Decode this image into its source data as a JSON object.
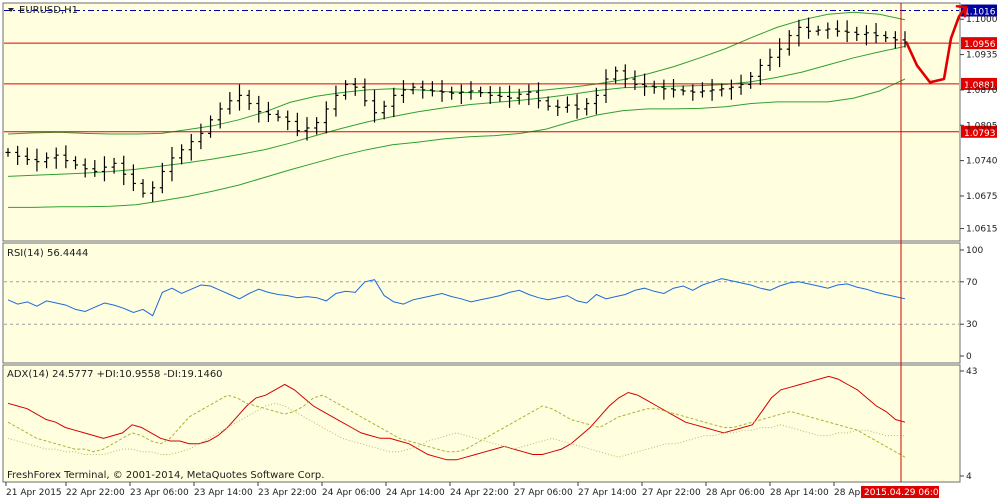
{
  "chart_data": [
    {
      "type": "candlestick",
      "title": "EURUSD,H1",
      "ylim": [
        1.0594,
        1.1028
      ],
      "y_ticks": [
        "1.1000",
        "1.0935",
        "1.0870",
        "1.0805",
        "1.0740",
        "1.0675",
        "1.0615"
      ],
      "x_ticks": [
        "21 Apr 2015",
        "22 Apr 22:00",
        "23 Apr 06:00",
        "23 Apr 14:00",
        "23 Apr 22:00",
        "24 Apr 06:00",
        "24 Apr 14:00",
        "24 Apr 22:00",
        "27 Apr 06:00",
        "27 Apr 14:00",
        "27 Apr 22:00",
        "28 Apr 06:00",
        "28 Apr 14:00",
        "28 Apr",
        "2015.04.29 06:00"
      ],
      "cursor_time": "2015.04.29 06:00",
      "price_levels": [
        {
          "label": "1.1016",
          "value": 1.1016,
          "style": "dash-dot",
          "color": "#0000a0"
        },
        {
          "label": "1.0956",
          "value": 1.0956,
          "style": "solid",
          "color": "#e00000"
        },
        {
          "label": "1.0881",
          "value": 1.0881,
          "style": "solid",
          "color": "#e00000"
        },
        {
          "label": "1.0793",
          "value": 1.0793,
          "style": "solid",
          "color": "#e00000"
        }
      ],
      "bollinger_bands": {
        "upper": [
          1.0789,
          1.0791,
          1.0792,
          1.079,
          1.0789,
          1.0789,
          1.079,
          1.0797,
          1.0804,
          1.0815,
          1.0829,
          1.0847,
          1.0858,
          1.0865,
          1.087,
          1.0872,
          1.087,
          1.0867,
          1.0865,
          1.0865,
          1.0866,
          1.087,
          1.0875,
          1.0881,
          1.0889,
          1.09,
          1.0913,
          1.0929,
          1.0946,
          1.0966,
          1.0985,
          1.0999,
          1.1009,
          1.1013,
          1.1009,
          1.0999
        ],
        "middle": [
          1.0711,
          1.0713,
          1.0715,
          1.0717,
          1.072,
          1.0724,
          1.073,
          1.0736,
          1.0743,
          1.0751,
          1.076,
          1.0772,
          1.0786,
          1.0799,
          1.0811,
          1.0821,
          1.083,
          1.0837,
          1.0843,
          1.0847,
          1.0851,
          1.0856,
          1.0862,
          1.0869,
          1.0874,
          1.0876,
          1.0877,
          1.0878,
          1.088,
          1.0885,
          1.0893,
          1.0903,
          1.0916,
          1.0929,
          1.094,
          1.095
        ],
        "lower": [
          1.0654,
          1.0654,
          1.0655,
          1.0655,
          1.0656,
          1.0659,
          1.0666,
          1.0674,
          1.0684,
          1.0695,
          1.0709,
          1.0723,
          1.0736,
          1.0749,
          1.076,
          1.0769,
          1.0774,
          1.078,
          1.0784,
          1.0786,
          1.079,
          1.0798,
          1.0812,
          1.0824,
          1.0832,
          1.0835,
          1.0835,
          1.0836,
          1.0839,
          1.0845,
          1.0848,
          1.0848,
          1.0848,
          1.0855,
          1.0868,
          1.089
        ]
      },
      "forecast_arrow": {
        "color": "#e00000",
        "points": [
          [
            1.0955
          ],
          [
            1.0915
          ],
          [
            1.0884
          ],
          [
            1.089
          ],
          [
            1.0965
          ],
          [
            1.1005
          ],
          [
            1.1022
          ]
        ]
      }
    },
    {
      "type": "line",
      "title": "RSI(14) 56.4444",
      "ylim": [
        0,
        100
      ],
      "y_ticks": [
        "100",
        "70",
        "30",
        "0"
      ],
      "levels": [
        70,
        30
      ],
      "series": [
        {
          "color": "#1e6ad8",
          "values": [
            53,
            49,
            51,
            47,
            52,
            50,
            48,
            44,
            42,
            46,
            50,
            48,
            45,
            41,
            44,
            38,
            60,
            64,
            59,
            63,
            67,
            66,
            62,
            58,
            54,
            59,
            63,
            60,
            58,
            57,
            55,
            56,
            55,
            52,
            59,
            61,
            60,
            70,
            72,
            57,
            51,
            49,
            53,
            55,
            57,
            59,
            56,
            54,
            51,
            53,
            55,
            57,
            60,
            62,
            58,
            55,
            53,
            55,
            57,
            52,
            50,
            58,
            54,
            56,
            58,
            62,
            64,
            61,
            59,
            64,
            66,
            62,
            67,
            70,
            73,
            71,
            69,
            67,
            64,
            62,
            66,
            69,
            70,
            68,
            66,
            64,
            67,
            68,
            65,
            63,
            60,
            58,
            56,
            54
          ]
        }
      ]
    },
    {
      "type": "line",
      "title": "ADX(14) 24.5777 +DI:10.9558 -DI:19.1460",
      "ylim": [
        4,
        43
      ],
      "y_ticks": [
        "43",
        "4"
      ],
      "series": [
        {
          "name": "ADX",
          "style": "solid",
          "color": "#d40000",
          "values": [
            31,
            30,
            29,
            27,
            25,
            24,
            22,
            21,
            20,
            19,
            18,
            19,
            20,
            23,
            22,
            20,
            18,
            17,
            17,
            16,
            16,
            17,
            19,
            22,
            26,
            30,
            33,
            34,
            36,
            38,
            36,
            33,
            30,
            28,
            26,
            24,
            22,
            20,
            19,
            18,
            18,
            17,
            16,
            14,
            12,
            11,
            10,
            10,
            11,
            12,
            13,
            14,
            15,
            14,
            13,
            12,
            12,
            13,
            14,
            16,
            19,
            22,
            26,
            30,
            33,
            35,
            34,
            32,
            30,
            28,
            26,
            24,
            23,
            22,
            21,
            20,
            21,
            22,
            23,
            28,
            33,
            36,
            37,
            38,
            39,
            40,
            41,
            40,
            38,
            36,
            33,
            30,
            28,
            25,
            24
          ]
        },
        {
          "name": "+DI",
          "style": "dashed",
          "color": "#a8b430",
          "values": [
            24,
            22,
            20,
            18,
            17,
            16,
            15,
            14,
            14,
            13,
            14,
            16,
            18,
            20,
            19,
            17,
            16,
            18,
            22,
            26,
            28,
            30,
            32,
            34,
            33,
            31,
            30,
            29,
            28,
            27,
            28,
            30,
            33,
            34,
            32,
            30,
            28,
            26,
            24,
            22,
            20,
            18,
            17,
            16,
            15,
            14,
            13,
            13,
            14,
            16,
            18,
            20,
            22,
            24,
            26,
            28,
            30,
            29,
            27,
            25,
            24,
            23,
            22,
            24,
            26,
            27,
            28,
            29,
            29,
            28,
            27,
            26,
            25,
            24,
            23,
            22,
            22,
            23,
            24,
            25,
            26,
            27,
            28,
            27,
            26,
            25,
            24,
            23,
            22,
            21,
            19,
            17,
            15,
            13,
            11
          ]
        },
        {
          "name": "-DI",
          "style": "dotted",
          "color": "#b8b870",
          "values": [
            18,
            17,
            16,
            15,
            14,
            14,
            13,
            13,
            12,
            12,
            12,
            13,
            14,
            14,
            13,
            13,
            12,
            12,
            13,
            14,
            16,
            18,
            20,
            22,
            24,
            26,
            28,
            30,
            31,
            30,
            28,
            26,
            24,
            22,
            20,
            18,
            17,
            16,
            15,
            14,
            13,
            13,
            14,
            15,
            17,
            18,
            19,
            20,
            19,
            18,
            17,
            16,
            15,
            14,
            15,
            16,
            17,
            18,
            17,
            16,
            15,
            14,
            13,
            12,
            11,
            12,
            13,
            14,
            15,
            16,
            16,
            17,
            18,
            19,
            19,
            20,
            20,
            21,
            21,
            22,
            22,
            23,
            22,
            21,
            20,
            19,
            19,
            20,
            20,
            21,
            21,
            20,
            19,
            19,
            19
          ]
        }
      ]
    }
  ],
  "footer": {
    "copyright": "FreshForex Terminal, © 2001-2014, MetaQuotes Software Corp."
  }
}
